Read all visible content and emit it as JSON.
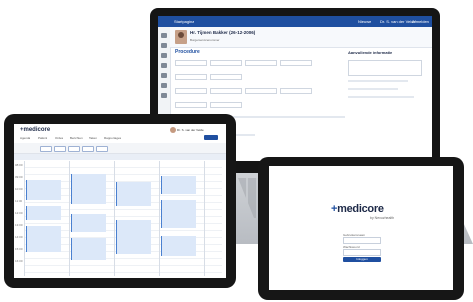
{
  "laptop": {
    "app_name": "Startpagina",
    "topbar_right": [
      "Nieuwe",
      "Dr. S. van der Velde",
      "Afmelden"
    ],
    "patient_name": "Hr. Tijmen Bakker (26-12-2006)",
    "patient_info": "Burgerservicenummer",
    "form_title": "Procedure",
    "right_panel_title": "Aanvullende informatie"
  },
  "tablet_left": {
    "logo": "+medicore",
    "menu": [
      "Agenda",
      "Patiënt",
      "Ordes",
      "Berichten",
      "Taken",
      "Rapportages"
    ],
    "user": "Dr. S. van der Velde",
    "times": [
      "08:00",
      "09:00",
      "10:00",
      "11:00",
      "12:00",
      "13:00",
      "14:00",
      "15:00",
      "16:00"
    ]
  },
  "tablet_right": {
    "logo_plus": "+",
    "logo_text": "medicore",
    "logo_sub": "by Nexuzhealth",
    "username_label": "Gebruikersnaam",
    "password_label": "Wachtwoord",
    "login_button": "Inloggen"
  },
  "colors": {
    "brand": "#1f4fa0",
    "appointment": "#dce8f9"
  }
}
